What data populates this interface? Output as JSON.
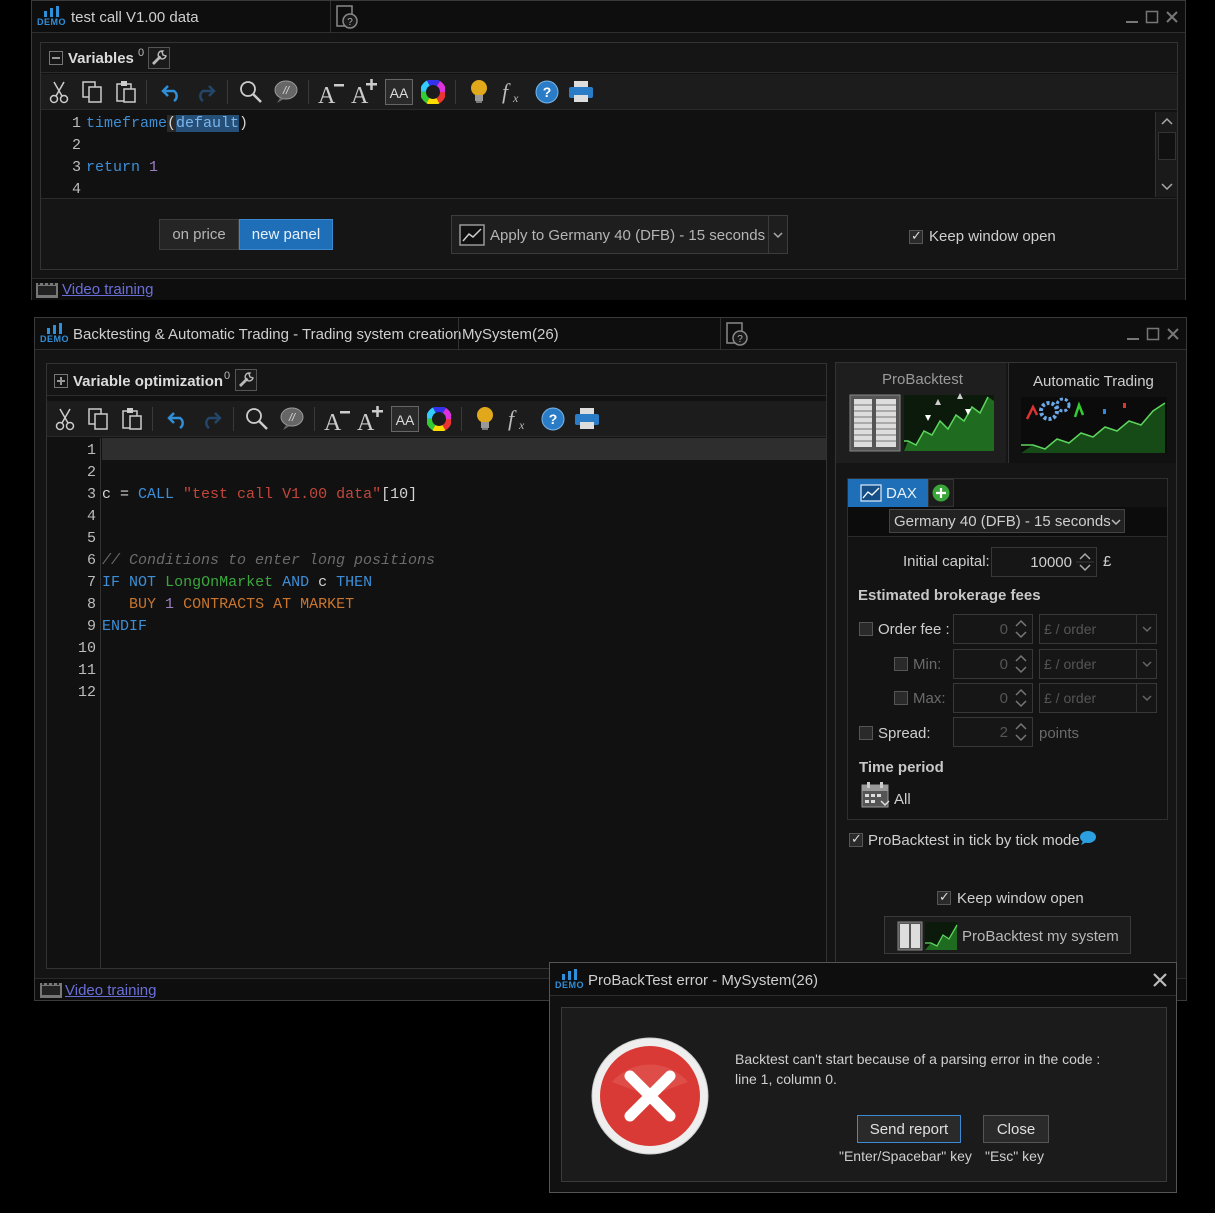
{
  "colors": {
    "accent": "#1f6fb8",
    "background": "#000000",
    "panel": "#141414",
    "error_red": "#d93a35"
  },
  "window1": {
    "title": "test call V1.00 data",
    "demo_label": "DEMO",
    "panel_title": "Variables",
    "panel_count": "0",
    "code": {
      "line_numbers": [
        "1",
        "2",
        "3",
        "4"
      ],
      "line1": {
        "fn": "timeframe",
        "open": "(",
        "arg": "default",
        "close": ")"
      },
      "line3": {
        "kw": "return",
        "num": "1"
      }
    },
    "btn_on_price": "on price",
    "btn_new_panel": "new panel",
    "apply_label": "Apply to Germany 40 (DFB) - 15 seconds",
    "keep_open": "Keep window open",
    "video_training": "Video training"
  },
  "window2": {
    "title": "Backtesting & Automatic Trading - Trading system creation",
    "tab_name": "MySystem(26)",
    "demo_label": "DEMO",
    "panel_title": "Variable optimization",
    "panel_count": "0",
    "line_numbers": [
      "1",
      "2",
      "3",
      "4",
      "5",
      "6",
      "7",
      "8",
      "9",
      "10",
      "11",
      "12"
    ],
    "code": {
      "l3": {
        "var": "c",
        "eq": " = ",
        "kw": "CALL",
        "str": " \"test call V1.00 data\"",
        "idx": "[10]"
      },
      "l6": "// Conditions to enter long positions",
      "l7": {
        "if": "IF",
        "not": "NOT",
        "fn": "LongOnMarket",
        "and": "AND",
        "c": "c",
        "then": "THEN"
      },
      "l8": {
        "buy": "BUY",
        "num": "1",
        "contracts": "CONTRACTS",
        "at": "AT",
        "market": "MARKET"
      },
      "l9": "ENDIF"
    },
    "video_training": "Video training",
    "right": {
      "tab_probacktest": "ProBacktest",
      "tab_auto": "Automatic Trading",
      "instrument_tab": "DAX",
      "instrument_select": "Germany 40 (DFB) - 15 seconds",
      "initial_capital_label": "Initial capital:",
      "initial_capital_value": "10000",
      "currency": "£",
      "fees_title": "Estimated brokerage fees",
      "order_fee_label": "Order fee :",
      "min_label": "Min:",
      "max_label": "Max:",
      "spread_label": "Spread:",
      "order_fee_value": "0",
      "min_value": "0",
      "max_value": "0",
      "spread_value": "2",
      "unit_order": "£ / order",
      "unit_points": "points",
      "time_period_title": "Time period",
      "time_period_value": "All",
      "tick_mode": "ProBacktest in tick by tick mode",
      "keep_open": "Keep window open",
      "run_button": "ProBacktest my system"
    }
  },
  "dialog": {
    "title": "ProBackTest error - MySystem(26)",
    "demo_label": "DEMO",
    "message_line1": "Backtest can't start because of a parsing error in the code :",
    "message_line2": "line 1, column 0.",
    "send_report": "Send report",
    "close": "Close",
    "hint_send": "\"Enter/Spacebar\" key",
    "hint_close": "\"Esc\" key"
  }
}
